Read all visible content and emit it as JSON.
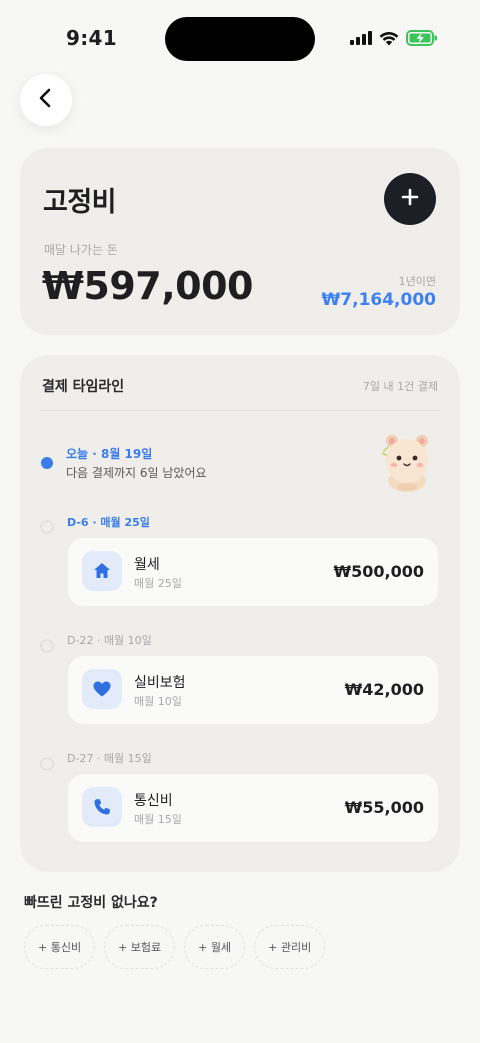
{
  "status_bar": {
    "time": "9:41"
  },
  "summary": {
    "title": "고정비",
    "monthly_label": "매달 나가는 돈",
    "monthly_amount": "₩597,000",
    "yearly_label": "1년이면",
    "yearly_amount": "₩7,164,000"
  },
  "timeline": {
    "title": "결제 타임라인",
    "meta": "7일 내 1건 결제",
    "today": {
      "label": "오늘 · 8월 19일",
      "sub": "다음 결제까지 6일 남았어요"
    },
    "items": [
      {
        "due_label": "D-6 · 매월 25일",
        "name": "월세",
        "schedule": "매월 25일",
        "amount": "₩500,000",
        "icon": "home-icon"
      },
      {
        "due_label": "D-22 · 매월 10일",
        "name": "실비보험",
        "schedule": "매월 10일",
        "amount": "₩42,000",
        "icon": "heart-icon"
      },
      {
        "due_label": "D-27 · 매월 15일",
        "name": "통신비",
        "schedule": "매월 15일",
        "amount": "₩55,000",
        "icon": "phone-icon"
      }
    ]
  },
  "missing": {
    "title": "빠뜨린 고정비 없나요?",
    "chips": [
      "+ 통신비",
      "+ 보험료",
      "+ 월세",
      "+ 관리비"
    ]
  },
  "colors": {
    "accent": "#3a7de9",
    "card_bg": "#efeeeb",
    "page_bg": "#f7f7f5",
    "dark_button": "#1c1f26"
  }
}
